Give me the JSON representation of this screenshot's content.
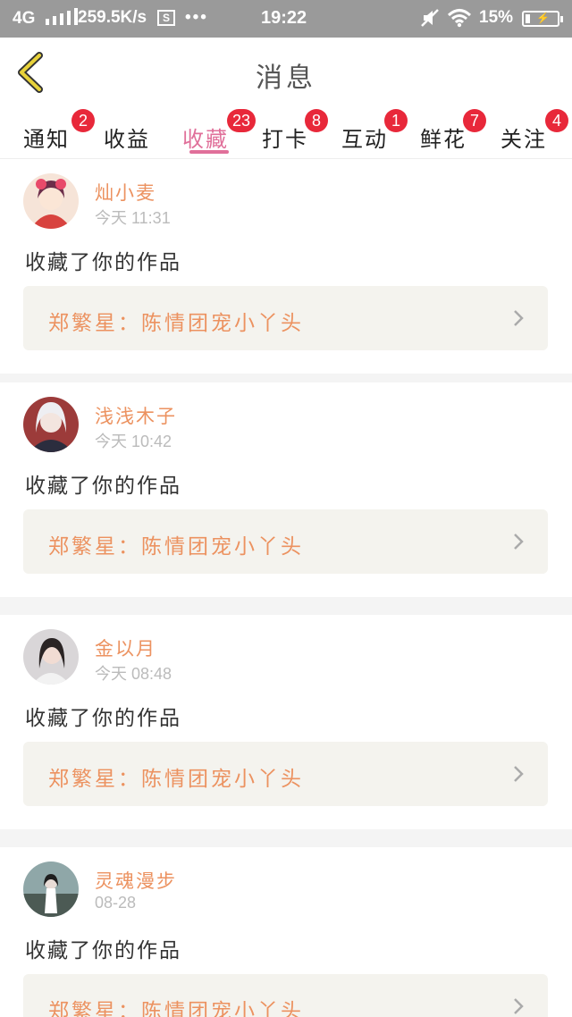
{
  "status_bar": {
    "network": "4G",
    "signal_icon": "signal-bars-icon",
    "speed": "259.5K/s",
    "sim": "S",
    "dots": "•••",
    "time": "19:22",
    "battery_percent": "15%",
    "battery_level": 0.15
  },
  "header": {
    "back_icon": "chevron-left-icon",
    "title": "消息",
    "accent_color": "#e8d23a"
  },
  "tabs": [
    {
      "label": "通知",
      "badge": "2",
      "active": false
    },
    {
      "label": "收益",
      "badge": "",
      "active": false
    },
    {
      "label": "收藏",
      "badge": "23",
      "active": true
    },
    {
      "label": "打卡",
      "badge": "8",
      "active": false
    },
    {
      "label": "互动",
      "badge": "1",
      "active": false
    },
    {
      "label": "鲜花",
      "badge": "7",
      "active": false
    },
    {
      "label": "关注",
      "badge": "4",
      "active": false
    }
  ],
  "colors": {
    "active_tab": "#e0709a",
    "badge": "#e8283a",
    "username": "#ec9260"
  },
  "messages": [
    {
      "username": "灿小麦",
      "time": "今天 11:31",
      "action": "收藏了你的作品",
      "work": "郑繁星：陈情团宠小丫头"
    },
    {
      "username": "浅浅木子",
      "time": "今天 10:42",
      "action": "收藏了你的作品",
      "work": "郑繁星：陈情团宠小丫头"
    },
    {
      "username": "金以月",
      "time": "今天 08:48",
      "action": "收藏了你的作品",
      "work": "郑繁星：陈情团宠小丫头"
    },
    {
      "username": "灵魂漫步",
      "time": "08-28",
      "action": "收藏了你的作品",
      "work": "郑繁星：陈情团宠小丫头"
    }
  ]
}
